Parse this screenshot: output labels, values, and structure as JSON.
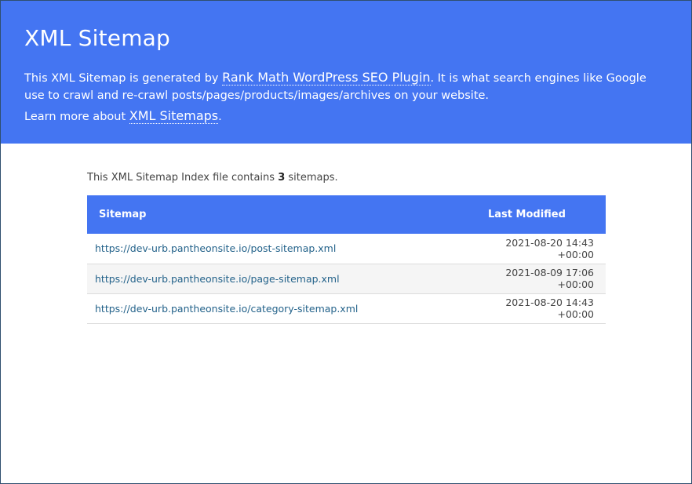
{
  "header": {
    "title": "XML Sitemap",
    "desc_prefix": "This XML Sitemap is generated by ",
    "plugin_link": "Rank Math WordPress SEO Plugin",
    "desc_suffix": ". It is what search engines like Google use to crawl and re-crawl posts/pages/products/images/archives on your website.",
    "learn_prefix": "Learn more about ",
    "learn_link": "XML Sitemaps",
    "learn_suffix": "."
  },
  "summary": {
    "prefix": "This XML Sitemap Index file contains ",
    "count": "3",
    "suffix": " sitemaps."
  },
  "table": {
    "headers": [
      "Sitemap",
      "Last Modified"
    ],
    "rows": [
      {
        "url": "https://dev-urb.pantheonsite.io/post-sitemap.xml",
        "modified": "2021-08-20 14:43 +00:00"
      },
      {
        "url": "https://dev-urb.pantheonsite.io/page-sitemap.xml",
        "modified": "2021-08-09 17:06 +00:00"
      },
      {
        "url": "https://dev-urb.pantheonsite.io/category-sitemap.xml",
        "modified": "2021-08-20 14:43 +00:00"
      }
    ]
  },
  "colors": {
    "header_bg": "#4475f2",
    "link": "#23628a",
    "alt_row": "#f5f5f5"
  }
}
